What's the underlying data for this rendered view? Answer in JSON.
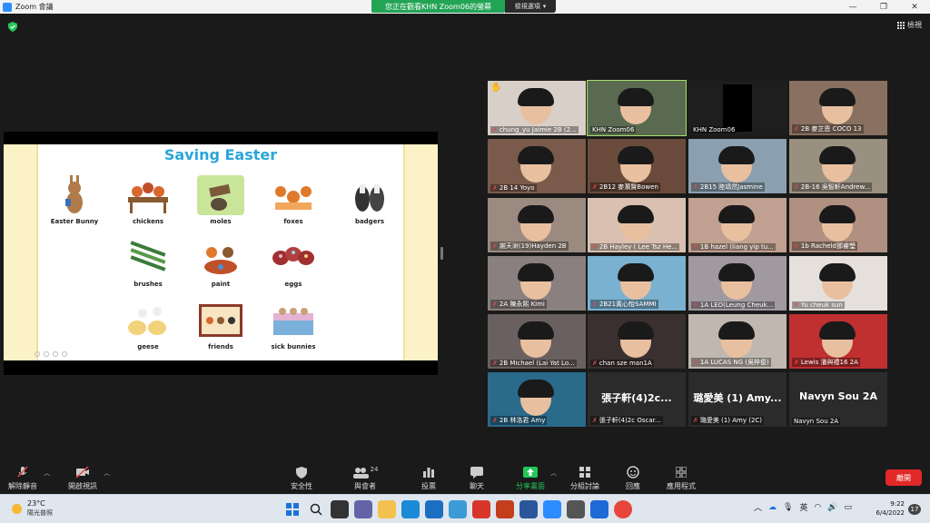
{
  "window": {
    "title": "Zoom 會議",
    "minimize": "—",
    "maximize": "❐",
    "close": "✕"
  },
  "share_banner": {
    "text": "您正在觀看KHN Zoom06的螢幕",
    "view_options": "檢視選項",
    "view_options_caret": "▾"
  },
  "view_button": {
    "label": "檢視"
  },
  "slide": {
    "title": "Saving Easter",
    "items": [
      {
        "label": "Easter Bunny"
      },
      {
        "label": "chickens"
      },
      {
        "label": "moles"
      },
      {
        "label": "foxes"
      },
      {
        "label": "badgers"
      },
      {
        "label": "brushes"
      },
      {
        "label": "paint"
      },
      {
        "label": "eggs"
      },
      {
        "label": "geese"
      },
      {
        "label": "friends"
      },
      {
        "label": "sick bunnies"
      }
    ]
  },
  "participants": [
    {
      "name": "chung_yu Jaimie 2B (2...",
      "muted": true,
      "hand": true
    },
    {
      "name": "KHN Zoom06",
      "muted": false,
      "active": true
    },
    {
      "name": "KHN Zoom06",
      "muted": false
    },
    {
      "name": "2B 麥芷恩 COCO 13",
      "muted": true
    },
    {
      "name": "2B 14 Yoyo",
      "muted": true
    },
    {
      "name": "2B12 麥灝賢Bowen",
      "muted": true
    },
    {
      "name": "2B15 陸靖然Jasmine",
      "muted": true
    },
    {
      "name": "2B-16 吳智軒Andrew...",
      "muted": true
    },
    {
      "name": "謝天澍(19)Hayden 2B",
      "muted": true
    },
    {
      "name": "2B Hayley ( Lee Tsz He...",
      "muted": true
    },
    {
      "name": "1B hazel (liang yip tu...",
      "muted": true
    },
    {
      "name": "1b Racheld鄧睿瑩",
      "muted": true
    },
    {
      "name": "2A 陳永熙 Kimi",
      "muted": true
    },
    {
      "name": "2B21黃心怡SAMMI",
      "muted": true
    },
    {
      "name": "1A LEO(Leung Cheuk...",
      "muted": true
    },
    {
      "name": "Yu cheuk sun",
      "muted": true
    },
    {
      "name": "2B Michael (Lai Yat Lo...",
      "muted": true
    },
    {
      "name": "chan sze man1A",
      "muted": true
    },
    {
      "name": "1A LUCAS NG (吳梓俊)",
      "muted": true
    },
    {
      "name": "Lewis 潘與禮16 2A",
      "muted": true
    },
    {
      "name": "2B 林洛君 Amy",
      "muted": true
    },
    {
      "name": "張子軒(4)2c Oscar...",
      "muted": true,
      "display": "張子軒(4)2c..."
    },
    {
      "name": "璐愛美 (1) Amy (2C)",
      "muted": true,
      "display": "璐愛美 (1) Amy..."
    },
    {
      "name": "Navyn Sou 2A",
      "muted": false,
      "display": "Navyn Sou 2A"
    }
  ],
  "toolbar": {
    "unmute": "解除靜音",
    "start_video": "開啟視訊",
    "security": "安全性",
    "participants": "與會者",
    "participants_count": "24",
    "polls": "投票",
    "chat": "聊天",
    "share_screen": "分享畫面",
    "breakout": "分組討論",
    "reactions": "回應",
    "apps": "應用程式",
    "leave": "離開"
  },
  "taskbar": {
    "temperature": "23°C",
    "weather": "陽光普照",
    "ime": "英",
    "time": "9:22",
    "date": "6/4/2022",
    "notifications": "17"
  },
  "colors": {
    "banner": "#23a455",
    "leave": "#e02828",
    "active_border": "#a8e06a",
    "slide_title": "#29a6d9"
  }
}
